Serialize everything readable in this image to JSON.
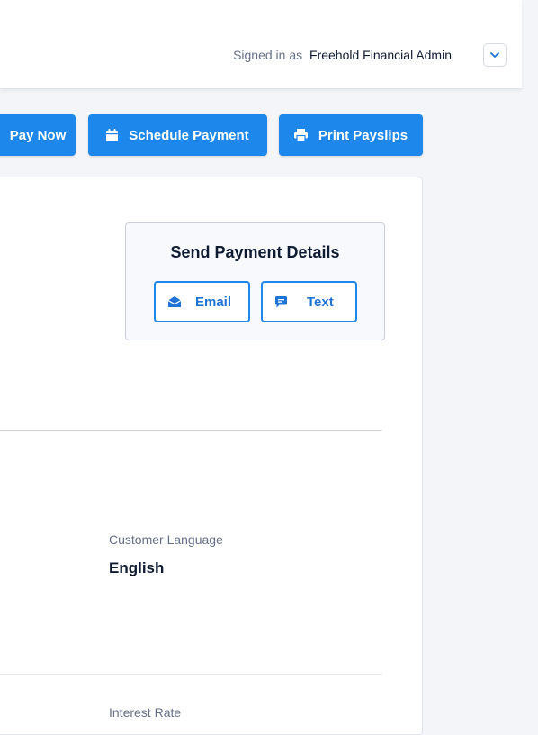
{
  "header": {
    "signed_in_prefix": "Signed in as",
    "user_name": "Freehold Financial Admin"
  },
  "actions": {
    "pay_now": "Pay Now",
    "schedule_payment": "Schedule Payment",
    "print_payslips": "Print Payslips"
  },
  "send_details": {
    "title": "Send Payment Details",
    "email_label": "Email",
    "text_label": "Text"
  },
  "fields": {
    "customer_language_label": "Customer Language",
    "customer_language_value": "English",
    "interest_rate_label": "Interest Rate"
  },
  "colors": {
    "primary": "#1e87eb",
    "text_dark": "#0f1a33",
    "text_muted": "#66708a"
  },
  "icons": {
    "user_menu": "chevron-down-icon",
    "schedule": "calendar-icon",
    "print": "printer-icon",
    "email": "envelope-open-icon",
    "text": "chat-bubble-icon"
  }
}
